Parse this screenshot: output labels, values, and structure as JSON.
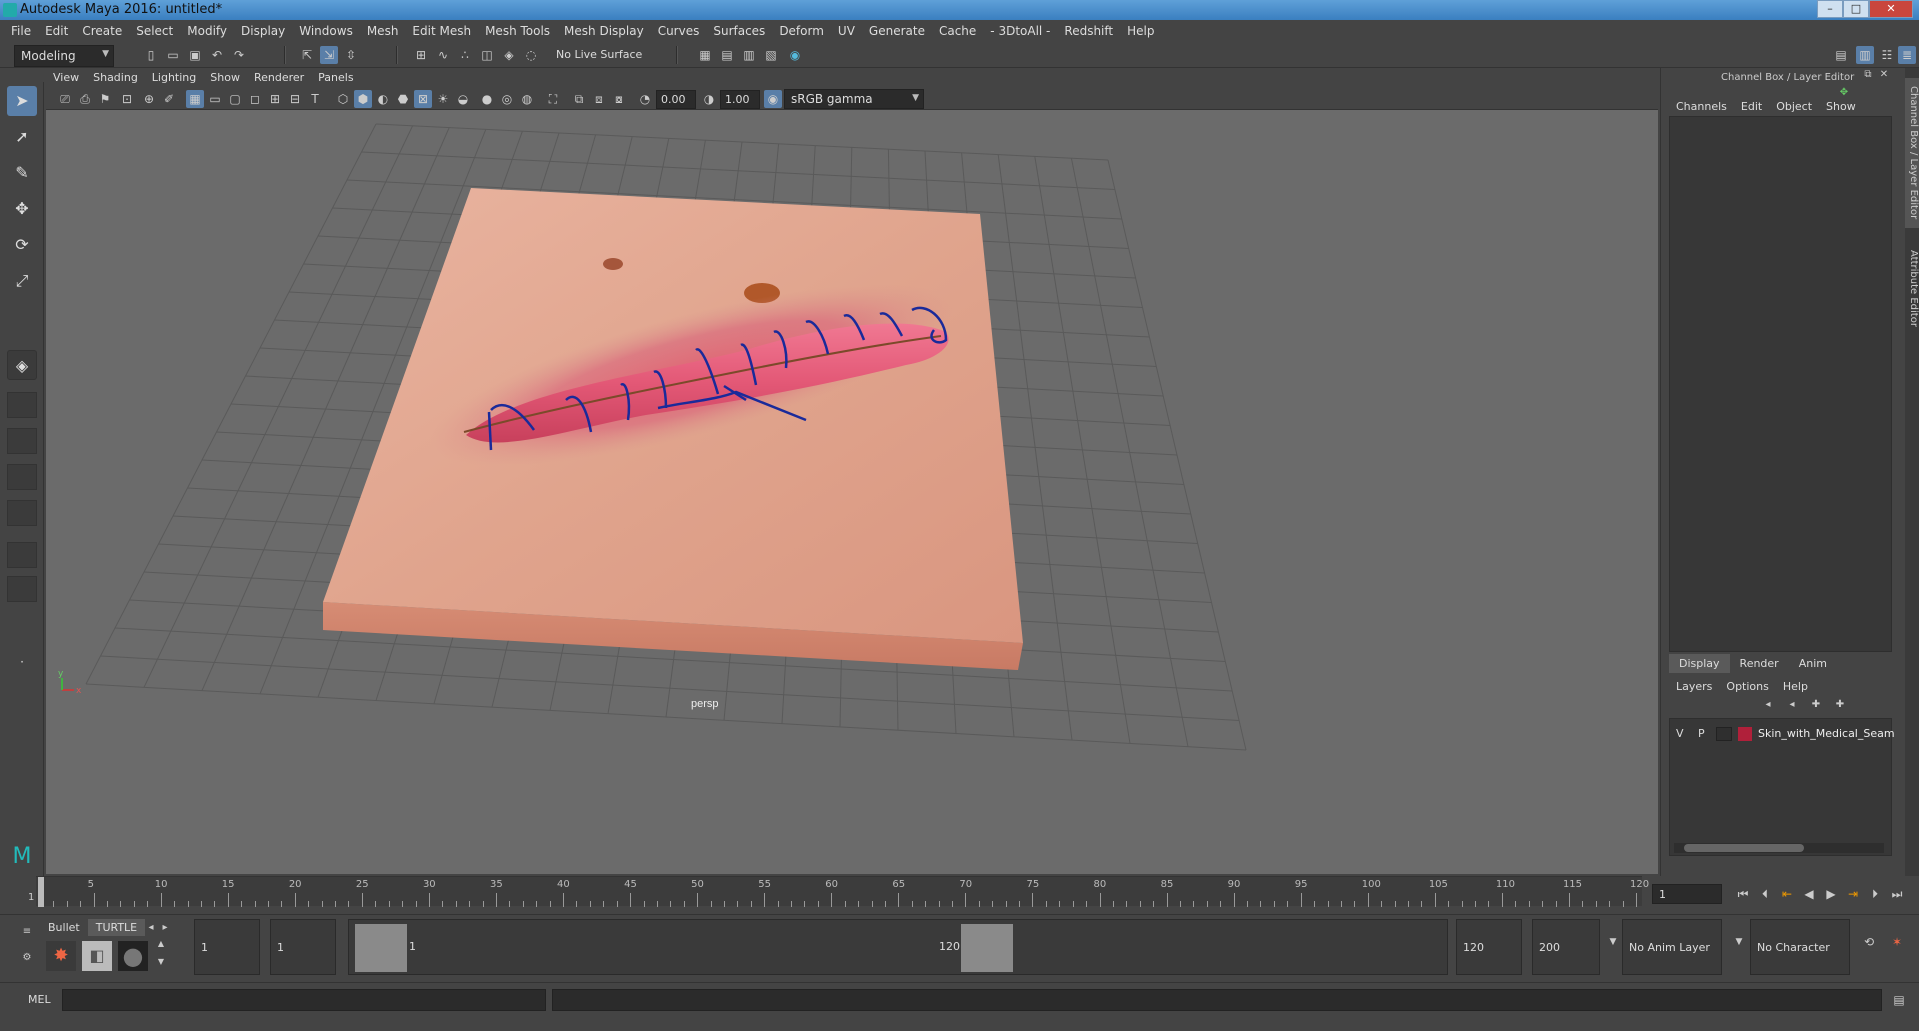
{
  "window": {
    "title": "Autodesk Maya 2016: untitled*",
    "min": "–",
    "max": "□",
    "close": "✕"
  },
  "menubar": [
    "File",
    "Edit",
    "Create",
    "Select",
    "Modify",
    "Display",
    "Windows",
    "Mesh",
    "Edit Mesh",
    "Mesh Tools",
    "Mesh Display",
    "Curves",
    "Surfaces",
    "Deform",
    "UV",
    "Generate",
    "Cache",
    "- 3DtoAll -",
    "Redshift",
    "Help"
  ],
  "status": {
    "mode": "Modeling",
    "live_surface": "No Live Surface"
  },
  "viewport": {
    "menus": [
      "View",
      "Shading",
      "Lighting",
      "Show",
      "Renderer",
      "Panels"
    ],
    "exposure": "0.00",
    "gamma": "1.00",
    "color_space": "sRGB gamma",
    "camera": "persp",
    "axis_y": "y",
    "axis_x": "x"
  },
  "channelbox": {
    "title": "Channel Box / Layer Editor",
    "menus": [
      "Channels",
      "Edit",
      "Object",
      "Show"
    ]
  },
  "layereditor": {
    "tabs": [
      "Display",
      "Render",
      "Anim"
    ],
    "active_tab": "Display",
    "menus": [
      "Layers",
      "Options",
      "Help"
    ],
    "layer": {
      "v": "V",
      "p": "P",
      "name": "Skin_with_Medical_Seam",
      "color": "#b0203a"
    }
  },
  "sidetabs": [
    "Channel Box / Layer Editor",
    "Attribute Editor"
  ],
  "timeline": {
    "ticks": [
      "5",
      "10",
      "15",
      "20",
      "25",
      "30",
      "35",
      "40",
      "45",
      "50",
      "55",
      "60",
      "65",
      "70",
      "75",
      "80",
      "85",
      "90",
      "95",
      "100",
      "105",
      "110",
      "115",
      "120"
    ],
    "start_label": "1",
    "current_frame": "1"
  },
  "range": {
    "start": "1",
    "range_start": "1",
    "slider_start": "1",
    "slider_end": "120",
    "range_end": "120",
    "end": "200",
    "anim_layer": "No Anim Layer",
    "character_set": "No Character Set"
  },
  "shelf": {
    "tabs": [
      "Bullet",
      "TURTLE"
    ]
  },
  "cmd": {
    "label": "MEL"
  }
}
